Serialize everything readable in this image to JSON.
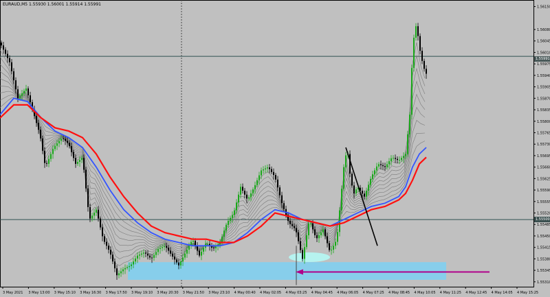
{
  "header": {
    "symbol_info": "EURAUD,M5  1.55930 1.56001 1.55914 1.55991"
  },
  "chart_data": {
    "type": "candlestick",
    "title": "",
    "y_ticks": [
      "1.56150",
      "1.56080",
      "1.56045",
      "1.56010",
      "1.55975",
      "1.55940",
      "1.55905",
      "1.55870",
      "1.55835",
      "1.55800",
      "1.55765",
      "1.55730",
      "1.55695",
      "1.55660",
      "1.55625",
      "1.55590",
      "1.55555",
      "1.55520",
      "1.55485",
      "1.55450",
      "1.55415",
      "1.55380",
      "1.55345",
      "1.55310"
    ],
    "ylim": [
      1.55295,
      1.5617
    ],
    "x_ticks": [
      "3 May 2021",
      "3 May 13:00",
      "3 May 15:10",
      "3 May 16:30",
      "3 May 17:50",
      "3 May 19:10",
      "3 May 20:30",
      "3 May 21:50",
      "3 May 23:10",
      "4 May 00:40",
      "4 May 02:05",
      "4 May 03:25",
      "4 May 04:45",
      "4 May 06:05",
      "4 May 07:25",
      "4 May 08:45",
      "4 May 10:05",
      "4 May 11:25",
      "4 May 12:45",
      "4 May 14:05",
      "4 May 15:25"
    ],
    "price_tags": [
      {
        "label": "1.55991",
        "value": 1.55991,
        "bg": "#4a5a5a"
      },
      {
        "label": "1.55500",
        "value": 1.555,
        "bg": "#3a4f4f"
      }
    ],
    "horizontal_lines": [
      1.55998,
      1.555
    ],
    "colors": {
      "bull": "#18a818",
      "bear": "#000000",
      "ema_fast": "#3355ff",
      "ema_slow": "#ff1010",
      "fan": "#7a7a7a",
      "zone": "#87ceeb",
      "oval": "#b6f3ef",
      "arrow": "#b0008a",
      "trend_line": "#000000"
    },
    "annotations": [
      "support-zone",
      "arrow",
      "trend-line",
      "oval-highlight",
      "period-separator"
    ],
    "close_path": [
      [
        0,
        1.5604
      ],
      [
        14,
        1.5598
      ],
      [
        26,
        1.5587
      ],
      [
        38,
        1.559
      ],
      [
        48,
        1.5583
      ],
      [
        58,
        1.5576
      ],
      [
        66,
        1.5566
      ],
      [
        78,
        1.5572
      ],
      [
        90,
        1.5575
      ],
      [
        100,
        1.5573
      ],
      [
        110,
        1.5567
      ],
      [
        120,
        1.5569
      ],
      [
        130,
        1.555
      ],
      [
        140,
        1.5553
      ],
      [
        150,
        1.5544
      ],
      [
        160,
        1.554
      ],
      [
        170,
        1.5533
      ],
      [
        180,
        1.5535
      ],
      [
        190,
        1.5536
      ],
      [
        200,
        1.5539
      ],
      [
        210,
        1.554
      ],
      [
        220,
        1.5538
      ],
      [
        230,
        1.5541
      ],
      [
        240,
        1.5542
      ],
      [
        250,
        1.5539
      ],
      [
        260,
        1.5536
      ],
      [
        270,
        1.554
      ],
      [
        280,
        1.5544
      ],
      [
        290,
        1.5539
      ],
      [
        300,
        1.5543
      ],
      [
        310,
        1.5541
      ],
      [
        320,
        1.5543
      ],
      [
        330,
        1.5549
      ],
      [
        340,
        1.5552
      ],
      [
        350,
        1.556
      ],
      [
        360,
        1.5556
      ],
      [
        370,
        1.556
      ],
      [
        380,
        1.5565
      ],
      [
        390,
        1.5566
      ],
      [
        400,
        1.5563
      ],
      [
        410,
        1.5555
      ],
      [
        420,
        1.5549
      ],
      [
        430,
        1.5547
      ],
      [
        440,
        1.5538
      ],
      [
        450,
        1.555
      ],
      [
        460,
        1.5544
      ],
      [
        470,
        1.5547
      ],
      [
        480,
        1.554
      ],
      [
        490,
        1.5544
      ],
      [
        500,
        1.5566
      ],
      [
        505,
        1.5572
      ],
      [
        510,
        1.5562
      ],
      [
        515,
        1.5558
      ],
      [
        520,
        1.556
      ],
      [
        530,
        1.5557
      ],
      [
        540,
        1.5563
      ],
      [
        550,
        1.5567
      ],
      [
        560,
        1.5566
      ],
      [
        570,
        1.5569
      ],
      [
        580,
        1.5568
      ],
      [
        590,
        1.557
      ],
      [
        596,
        1.5582
      ],
      [
        600,
        1.5601
      ],
      [
        604,
        1.561
      ],
      [
        608,
        1.5606
      ],
      [
        612,
        1.56
      ],
      [
        617,
        1.5596
      ],
      [
        621,
        1.5594
      ]
    ],
    "ema_fast": [
      [
        0,
        1.5582
      ],
      [
        20,
        1.5587
      ],
      [
        40,
        1.5586
      ],
      [
        60,
        1.5581
      ],
      [
        80,
        1.5577
      ],
      [
        100,
        1.5575
      ],
      [
        120,
        1.5572
      ],
      [
        140,
        1.5566
      ],
      [
        160,
        1.5559
      ],
      [
        180,
        1.5553
      ],
      [
        200,
        1.5549
      ],
      [
        220,
        1.5546
      ],
      [
        240,
        1.5544
      ],
      [
        260,
        1.5543
      ],
      [
        280,
        1.5542
      ],
      [
        300,
        1.5542
      ],
      [
        320,
        1.5542
      ],
      [
        340,
        1.5543
      ],
      [
        360,
        1.5546
      ],
      [
        380,
        1.555
      ],
      [
        400,
        1.5553
      ],
      [
        420,
        1.5552
      ],
      [
        440,
        1.555
      ],
      [
        460,
        1.5549
      ],
      [
        480,
        1.5548
      ],
      [
        500,
        1.555
      ],
      [
        520,
        1.5552
      ],
      [
        540,
        1.5554
      ],
      [
        560,
        1.5555
      ],
      [
        580,
        1.5557
      ],
      [
        590,
        1.556
      ],
      [
        600,
        1.5566
      ],
      [
        610,
        1.557
      ],
      [
        620,
        1.5572
      ]
    ],
    "ema_slow": [
      [
        0,
        1.5581
      ],
      [
        20,
        1.5585
      ],
      [
        40,
        1.5585
      ],
      [
        60,
        1.5581
      ],
      [
        80,
        1.5578
      ],
      [
        100,
        1.5577
      ],
      [
        120,
        1.5575
      ],
      [
        140,
        1.557
      ],
      [
        160,
        1.5563
      ],
      [
        180,
        1.5557
      ],
      [
        200,
        1.5552
      ],
      [
        220,
        1.5548
      ],
      [
        240,
        1.5546
      ],
      [
        260,
        1.5545
      ],
      [
        280,
        1.5544
      ],
      [
        300,
        1.5544
      ],
      [
        320,
        1.5543
      ],
      [
        340,
        1.5543
      ],
      [
        360,
        1.5545
      ],
      [
        380,
        1.5548
      ],
      [
        400,
        1.5552
      ],
      [
        420,
        1.5551
      ],
      [
        440,
        1.555
      ],
      [
        460,
        1.5549
      ],
      [
        480,
        1.5548
      ],
      [
        500,
        1.5549
      ],
      [
        520,
        1.5551
      ],
      [
        540,
        1.5553
      ],
      [
        560,
        1.5554
      ],
      [
        580,
        1.5556
      ],
      [
        590,
        1.5558
      ],
      [
        600,
        1.5562
      ],
      [
        610,
        1.5567
      ],
      [
        620,
        1.5569
      ]
    ]
  }
}
